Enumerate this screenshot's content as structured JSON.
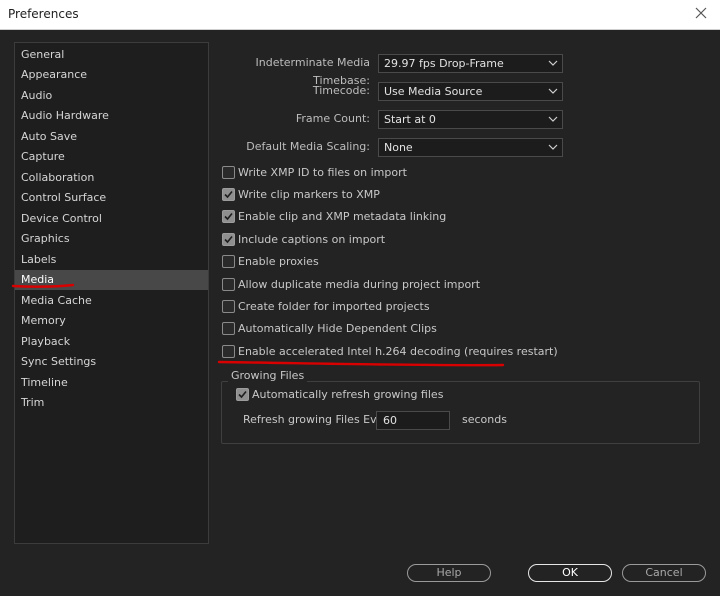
{
  "window": {
    "title": "Preferences",
    "close_icon": "close-icon"
  },
  "sidebar": {
    "items": [
      {
        "label": "General"
      },
      {
        "label": "Appearance"
      },
      {
        "label": "Audio"
      },
      {
        "label": "Audio Hardware"
      },
      {
        "label": "Auto Save"
      },
      {
        "label": "Capture"
      },
      {
        "label": "Collaboration"
      },
      {
        "label": "Control Surface"
      },
      {
        "label": "Device Control"
      },
      {
        "label": "Graphics"
      },
      {
        "label": "Labels"
      },
      {
        "label": "Media"
      },
      {
        "label": "Media Cache"
      },
      {
        "label": "Memory"
      },
      {
        "label": "Playback"
      },
      {
        "label": "Sync Settings"
      },
      {
        "label": "Timeline"
      },
      {
        "label": "Trim"
      }
    ],
    "selected": "Media"
  },
  "settings": {
    "timebase": {
      "label": "Indeterminate Media Timebase:",
      "value": "29.97 fps Drop-Frame"
    },
    "timecode": {
      "label": "Timecode:",
      "value": "Use Media Source"
    },
    "frame_count": {
      "label": "Frame Count:",
      "value": "Start at 0"
    },
    "scaling": {
      "label": "Default Media Scaling:",
      "value": "None"
    }
  },
  "checkboxes": [
    {
      "label": "Write XMP ID to files on import",
      "checked": false
    },
    {
      "label": "Write clip markers to XMP",
      "checked": true
    },
    {
      "label": "Enable clip and XMP metadata linking",
      "checked": true
    },
    {
      "label": "Include captions on import",
      "checked": true
    },
    {
      "label": "Enable proxies",
      "checked": false
    },
    {
      "label": "Allow duplicate media during project import",
      "checked": false
    },
    {
      "label": "Create folder for imported projects",
      "checked": false
    },
    {
      "label": "Automatically Hide Dependent Clips",
      "checked": false
    },
    {
      "label": "Enable accelerated Intel h.264 decoding (requires restart)",
      "checked": false
    }
  ],
  "growing_files": {
    "title": "Growing Files",
    "auto_refresh": {
      "label": "Automatically refresh growing files",
      "checked": true
    },
    "refresh_label": "Refresh growing Files Every",
    "refresh_value": "60",
    "refresh_unit": "seconds"
  },
  "buttons": {
    "help": "Help",
    "ok": "OK",
    "cancel": "Cancel"
  },
  "colors": {
    "background": "#232323",
    "selected_item": "#484848",
    "annotation": "#d80000"
  }
}
